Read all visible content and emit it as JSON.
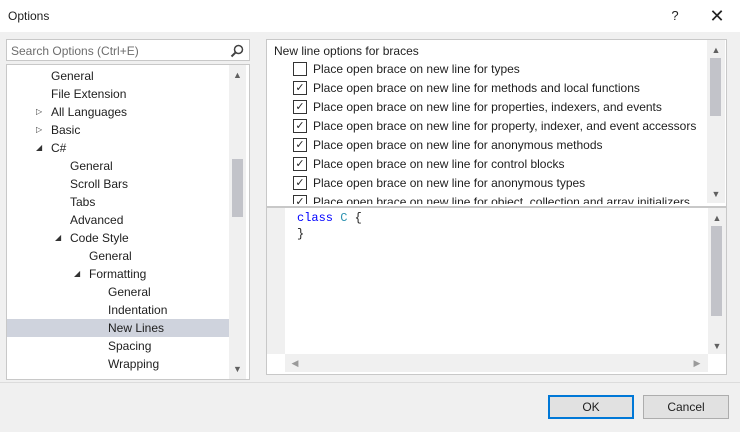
{
  "window": {
    "title": "Options",
    "help_glyph": "?",
    "close_glyph": "✕"
  },
  "search": {
    "placeholder": "Search Options (Ctrl+E)"
  },
  "tree": {
    "items": [
      {
        "label": "General",
        "arrow": ""
      },
      {
        "label": "File Extension",
        "arrow": ""
      },
      {
        "label": "All Languages",
        "arrow": "▷"
      },
      {
        "label": "Basic",
        "arrow": "▷"
      },
      {
        "label": "C#",
        "arrow": "◢"
      },
      {
        "label": "General",
        "arrow": ""
      },
      {
        "label": "Scroll Bars",
        "arrow": ""
      },
      {
        "label": "Tabs",
        "arrow": ""
      },
      {
        "label": "Advanced",
        "arrow": ""
      },
      {
        "label": "Code Style",
        "arrow": "◢"
      },
      {
        "label": "General",
        "arrow": ""
      },
      {
        "label": "Formatting",
        "arrow": "◢"
      },
      {
        "label": "General",
        "arrow": ""
      },
      {
        "label": "Indentation",
        "arrow": ""
      },
      {
        "label": "New Lines",
        "arrow": "",
        "selected": true
      },
      {
        "label": "Spacing",
        "arrow": ""
      },
      {
        "label": "Wrapping",
        "arrow": ""
      }
    ]
  },
  "options": {
    "header": "New line options for braces",
    "items": [
      {
        "label": "Place open brace on new line for types",
        "checked": false
      },
      {
        "label": "Place open brace on new line for methods and local functions",
        "checked": true
      },
      {
        "label": "Place open brace on new line for properties, indexers, and events",
        "checked": true
      },
      {
        "label": "Place open brace on new line for property, indexer, and event accessors",
        "checked": true
      },
      {
        "label": "Place open brace on new line for anonymous methods",
        "checked": true
      },
      {
        "label": "Place open brace on new line for control blocks",
        "checked": true
      },
      {
        "label": "Place open brace on new line for anonymous types",
        "checked": true
      },
      {
        "label": "Place open brace on new line for object, collection and array initializers",
        "checked": true
      }
    ]
  },
  "preview": {
    "keyword": "class",
    "type_name": "C",
    "open_brace": "{",
    "close_brace": "}"
  },
  "buttons": {
    "ok": "OK",
    "cancel": "Cancel"
  },
  "scroll_glyphs": {
    "up": "▲",
    "down": "▼",
    "left": "◀",
    "right": "▶"
  }
}
